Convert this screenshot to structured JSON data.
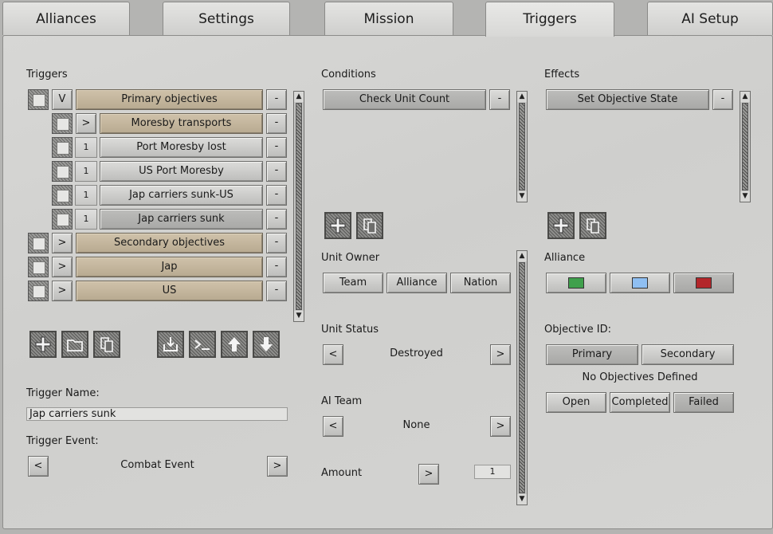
{
  "tabs": [
    "Alliances",
    "Settings",
    "Mission",
    "Triggers",
    "AI Setup"
  ],
  "triggers": {
    "label": "Triggers",
    "rows": [
      {
        "expand": "V",
        "name": "Primary objectives",
        "remove": "-"
      },
      {
        "expand": ">",
        "name": "Moresby transports",
        "remove": "-"
      },
      {
        "count": "1",
        "name": "Port Moresby lost",
        "remove": "-"
      },
      {
        "count": "1",
        "name": "US Port Moresby",
        "remove": "-"
      },
      {
        "count": "1",
        "name": "Jap carriers sunk-US",
        "remove": "-"
      },
      {
        "count": "1",
        "name": "Jap carriers sunk",
        "remove": "-"
      },
      {
        "expand": ">",
        "name": "Secondary objectives",
        "remove": "-"
      },
      {
        "expand": ">",
        "name": "Jap",
        "remove": "-"
      },
      {
        "expand": ">",
        "name": "US",
        "remove": "-"
      }
    ],
    "toolbar_icons": [
      "add-icon",
      "folder-icon",
      "copy-icon",
      "import-icon",
      "console-icon",
      "arrow-up-icon",
      "arrow-down-icon"
    ]
  },
  "trigger_name": {
    "label": "Trigger Name:",
    "value": "Jap carriers sunk"
  },
  "trigger_event": {
    "label": "Trigger Event:",
    "value": "Combat Event",
    "prev": "<",
    "next": ">"
  },
  "conditions": {
    "label": "Conditions",
    "items": [
      {
        "name": "Check Unit Count",
        "remove": "-"
      }
    ],
    "unit_owner": {
      "label": "Unit Owner",
      "options": [
        "Team",
        "Alliance",
        "Nation"
      ]
    },
    "unit_status": {
      "label": "Unit Status",
      "value": "Destroyed",
      "prev": "<",
      "next": ">"
    },
    "ai_team": {
      "label": "AI Team",
      "value": "None",
      "prev": "<",
      "next": ">"
    },
    "amount": {
      "label": "Amount",
      "next": ">",
      "value": "1"
    }
  },
  "effects": {
    "label": "Effects",
    "items": [
      {
        "name": "Set Objective State",
        "remove": "-"
      }
    ],
    "alliance": {
      "label": "Alliance",
      "colors": [
        "#3fa04c",
        "#8fbff2",
        "#b3262a"
      ]
    },
    "objective_id": {
      "label": "Objective ID:",
      "options": [
        "Primary",
        "Secondary"
      ],
      "note": "No Objectives Defined"
    },
    "state_options": [
      "Open",
      "Completed",
      "Failed"
    ]
  },
  "scroll_arrows": {
    "up": "▲",
    "down": "▼"
  }
}
